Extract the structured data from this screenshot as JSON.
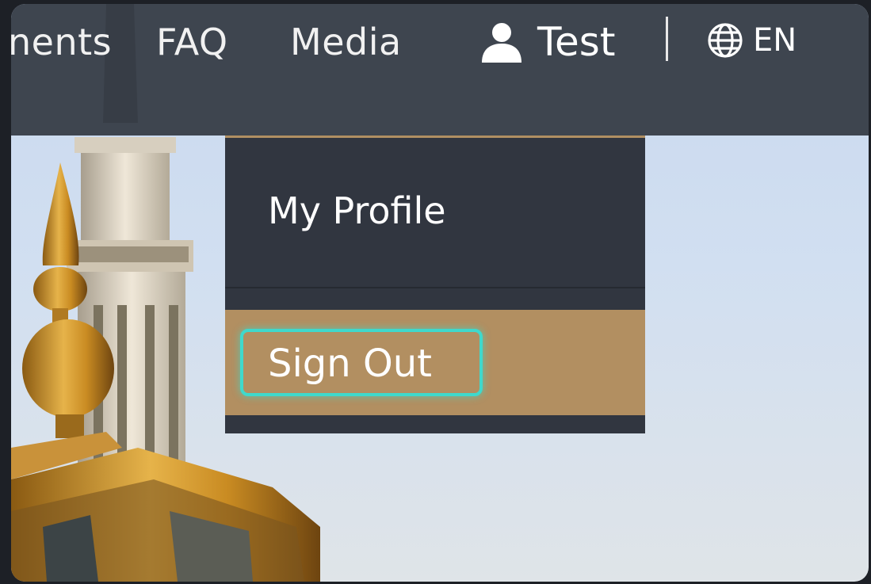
{
  "nav": {
    "links": [
      "nents",
      "FAQ",
      "Media"
    ],
    "user_label": "Test",
    "language_label": "EN"
  },
  "dropdown": {
    "items": [
      "My Profile",
      "Sign Out"
    ],
    "focused_item": "Sign Out"
  },
  "colors": {
    "navbar_bg": "#383e48",
    "dropdown_bg": "#313640",
    "accent_gold": "#b28f61",
    "focus_ring": "#3fd9cc",
    "text": "#ffffff"
  },
  "icons": {
    "user": "person-icon",
    "language": "globe-icon"
  }
}
